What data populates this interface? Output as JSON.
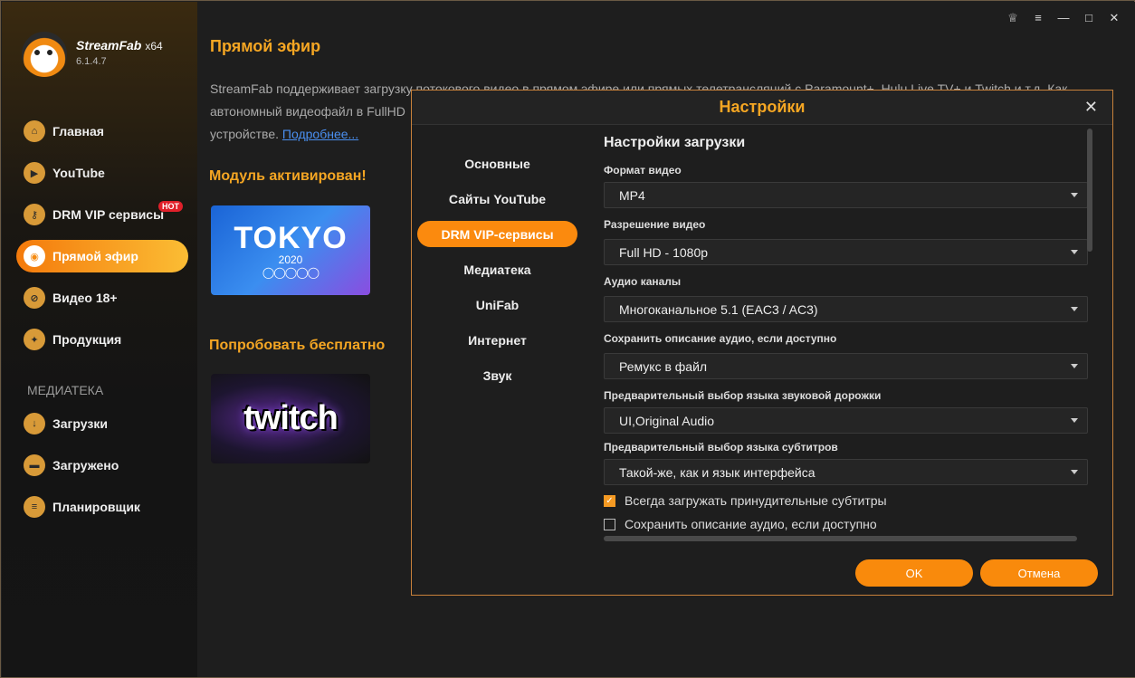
{
  "app": {
    "brand": "StreamFab",
    "arch": "x64",
    "version": "6.1.4.7"
  },
  "sidebar": {
    "items": [
      {
        "label": "Главная",
        "icon": "home-icon",
        "glyph": "⌂"
      },
      {
        "label": "YouTube",
        "icon": "youtube-icon",
        "glyph": "▶"
      },
      {
        "label": "DRM VIP сервисы",
        "icon": "key-icon",
        "glyph": "⚷"
      },
      {
        "label": "Прямой эфир",
        "icon": "live-icon",
        "glyph": "◉"
      },
      {
        "label": "Видео 18+",
        "icon": "adult-icon",
        "glyph": "⊘"
      },
      {
        "label": "Продукция",
        "icon": "products-icon",
        "glyph": "✦"
      }
    ],
    "hot_badge": "HOT",
    "library_label": "МЕДИАТЕКА",
    "library_items": [
      {
        "label": "Загрузки",
        "icon": "download-icon",
        "glyph": "↓"
      },
      {
        "label": "Загружено",
        "icon": "folder-icon",
        "glyph": "▬"
      },
      {
        "label": "Планировщик",
        "icon": "scheduler-icon",
        "glyph": "≡"
      }
    ]
  },
  "topbar": {
    "icons": [
      "skin-icon",
      "menu-icon",
      "minimize-icon",
      "maximize-icon",
      "close-icon"
    ],
    "glyphs": [
      "♕",
      "≡",
      "—",
      "□",
      "✕"
    ]
  },
  "main": {
    "title": "Прямой эфир",
    "description_l1": "StreamFab поддерживает загрузку потокового видео в прямом эфире или прямых телетрансляций с Paramount+, Hulu Live TV+ и Twitch и т.д. Как",
    "description_l2": "автономный видеофайл в FullHD",
    "description_l3": "устройстве.",
    "more_link": "Подробнее...",
    "activated_label": "Модуль активирован!",
    "try_free_label": "Попробовать бесплатно",
    "tokyo_card": {
      "text": "TOKYO",
      "year": "2020",
      "rings": "◯◯◯◯◯"
    },
    "twitch_card": {
      "text": "twitch"
    }
  },
  "dialog": {
    "title": "Настройки",
    "close": "✕",
    "nav": [
      "Основные",
      "Сайты YouTube",
      "DRM VIP-сервисы",
      "Медиатека",
      "UniFab",
      "Интернет",
      "Звук"
    ],
    "active_nav_index": 2,
    "section_title": "Настройки загрузки",
    "fields": [
      {
        "label": "Формат видео",
        "value": "MP4"
      },
      {
        "label": "Разрешение видео",
        "value": "Full HD - 1080p"
      },
      {
        "label": "Аудио каналы",
        "value": "Многоканальное 5.1 (EAC3 / AC3)"
      },
      {
        "label": "Сохранить описание аудио, если доступно",
        "value": "Ремукс в файл"
      },
      {
        "label": "Предварительный выбор языка звуковой дорожки",
        "value": "UI,Original Audio"
      },
      {
        "label": "Предварительный выбор языка субтитров",
        "value": "Такой-же, как и язык интерфейса"
      }
    ],
    "checkboxes": [
      {
        "label": "Всегда загружать принудительные субтитры",
        "checked": true
      },
      {
        "label": "Сохранить описание аудио, если доступно",
        "checked": false
      }
    ],
    "ok_label": "OK",
    "cancel_label": "Отмена",
    "accent": "#f98a0c"
  }
}
